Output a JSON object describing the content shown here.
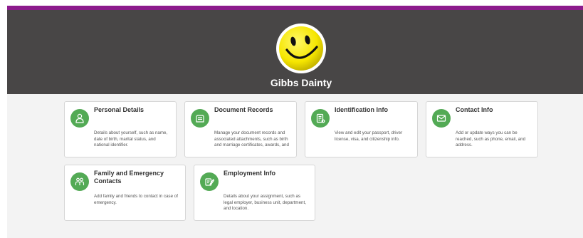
{
  "profile": {
    "name": "Gibbs Dainty",
    "avatar_icon": "smiley-face-icon",
    "colors": {
      "header": "#484646",
      "accent_bar": "#8c1b8c",
      "icon_green": "#53aa55"
    }
  },
  "cards": [
    {
      "title": "Personal Details",
      "description": "Details about yourself, such as name, date of birth, marital status, and national identifier.",
      "icon": "person-icon"
    },
    {
      "title": "Document Records",
      "description": "Manage your document records and associated attachments, such as birth and marriage certificates, awards, and",
      "icon": "document-folder-icon"
    },
    {
      "title": "Identification Info",
      "description": "View and edit your passport, driver license, visa, and citizenship info.",
      "icon": "id-card-icon"
    },
    {
      "title": "Contact Info",
      "description": "Add or update ways you can be reached, such as phone, email, and address.",
      "icon": "envelope-icon"
    },
    {
      "title": "Family and Emergency Contacts",
      "description": "Add family and friends to contact in case of emergency.",
      "icon": "family-icon"
    },
    {
      "title": "Employment Info",
      "description": "Details about your assignment, such as legal employer, business unit, department, and location.",
      "icon": "employment-icon"
    }
  ]
}
